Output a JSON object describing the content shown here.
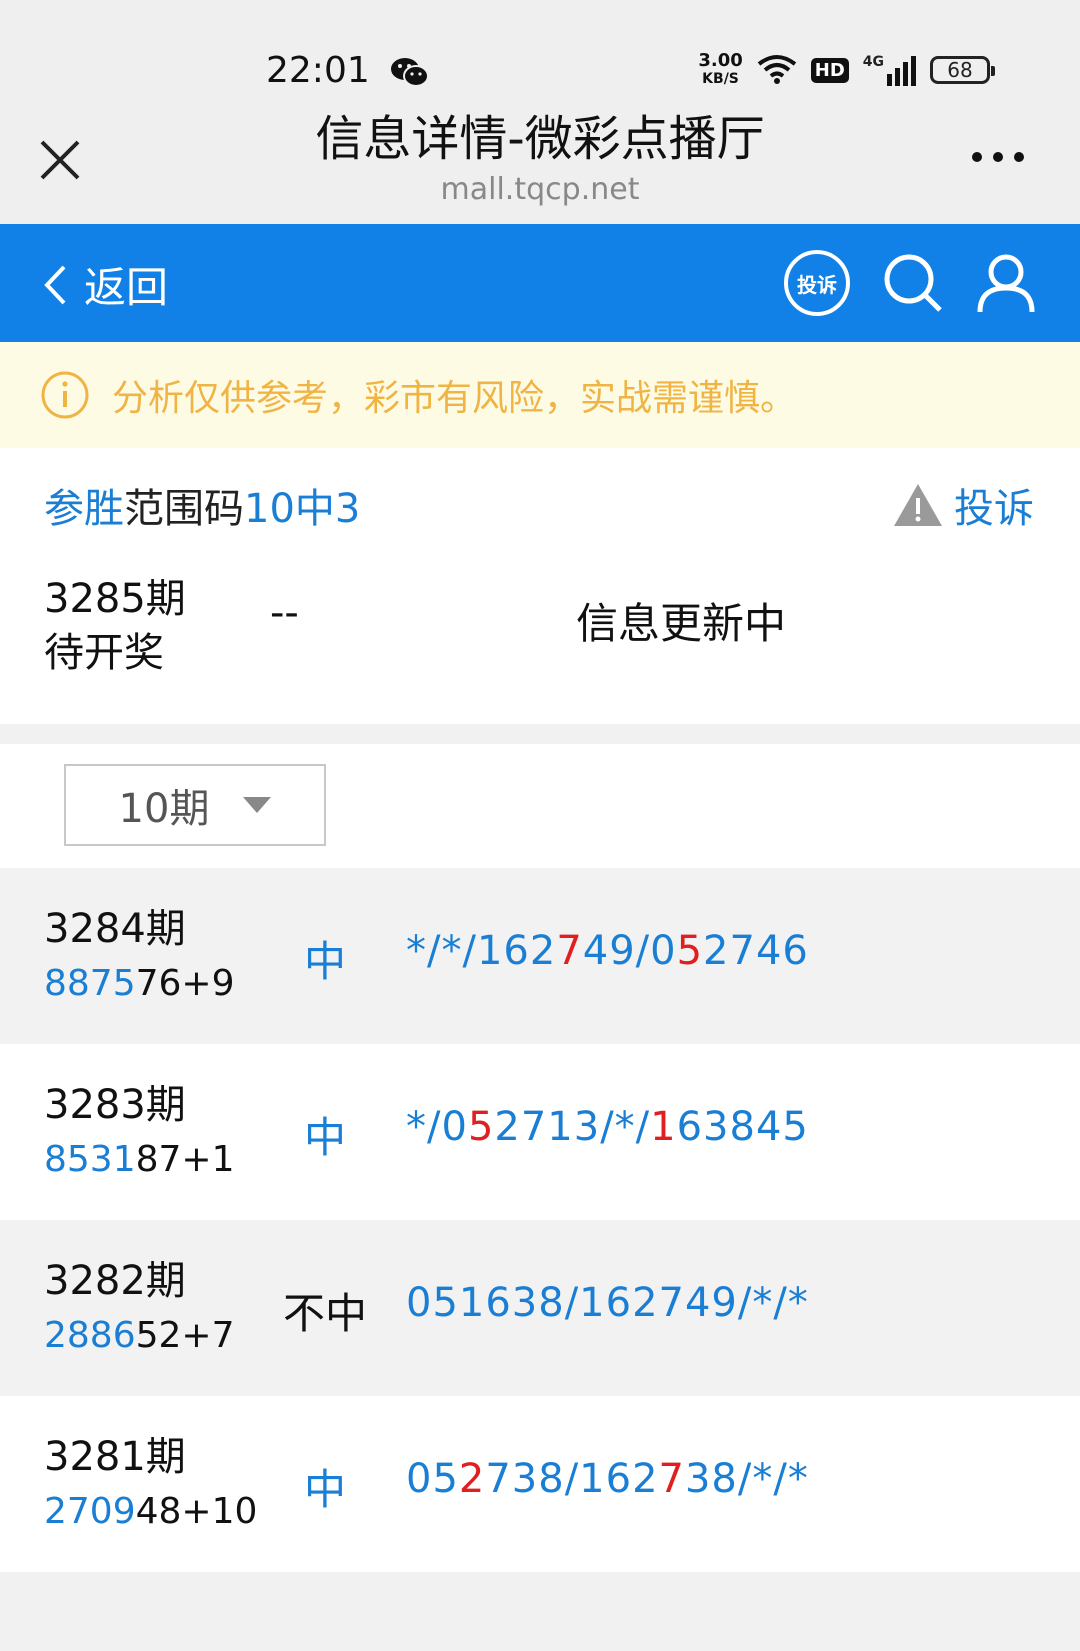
{
  "status": {
    "time": "22:01",
    "speed_top": "3.00",
    "speed_bottom": "KB/S",
    "hd": "HD",
    "network": "4G",
    "battery": "68"
  },
  "titlebar": {
    "title": "信息详情-微彩点播厅",
    "subtitle": "mall.tqcp.net"
  },
  "navbar": {
    "back_label": "返回",
    "complain_icon_text": "投诉"
  },
  "notice": {
    "text": "分析仅供参考，彩市有风险，实战需谨慎。"
  },
  "plan": {
    "title_part1": "参胜",
    "title_part2": "范围码",
    "title_part3": "10中3",
    "report_label": "投诉",
    "current_issue": "3285期",
    "current_state": "待开奖",
    "current_dash": "--",
    "current_status": "信息更新中"
  },
  "filter": {
    "selected": "10期"
  },
  "records": [
    {
      "issue": "3284期",
      "draw_blue": "8875",
      "draw_rest": "76+9",
      "result": "中",
      "hit": true,
      "pred": [
        [
          "*/*/162",
          "b"
        ],
        [
          "7",
          "r"
        ],
        [
          "49/0",
          "b"
        ],
        [
          "5",
          "r"
        ],
        [
          "2746",
          "b"
        ]
      ]
    },
    {
      "issue": "3283期",
      "draw_blue": "8531",
      "draw_rest": "87+1",
      "result": "中",
      "hit": true,
      "pred": [
        [
          "*/0",
          "b"
        ],
        [
          "5",
          "r"
        ],
        [
          "2713/*/",
          "b"
        ],
        [
          "1",
          "r"
        ],
        [
          "63845",
          "b"
        ]
      ]
    },
    {
      "issue": "3282期",
      "draw_blue": "2886",
      "draw_rest": "52+7",
      "result": "不中",
      "hit": false,
      "pred": [
        [
          "051638/162749/*/*",
          "b"
        ]
      ]
    },
    {
      "issue": "3281期",
      "draw_blue": "2709",
      "draw_rest": "48+10",
      "result": "中",
      "hit": true,
      "pred": [
        [
          "05",
          "b"
        ],
        [
          "2",
          "r"
        ],
        [
          "738/162",
          "b"
        ],
        [
          "7",
          "r"
        ],
        [
          "38/*/*",
          "b"
        ]
      ]
    }
  ]
}
